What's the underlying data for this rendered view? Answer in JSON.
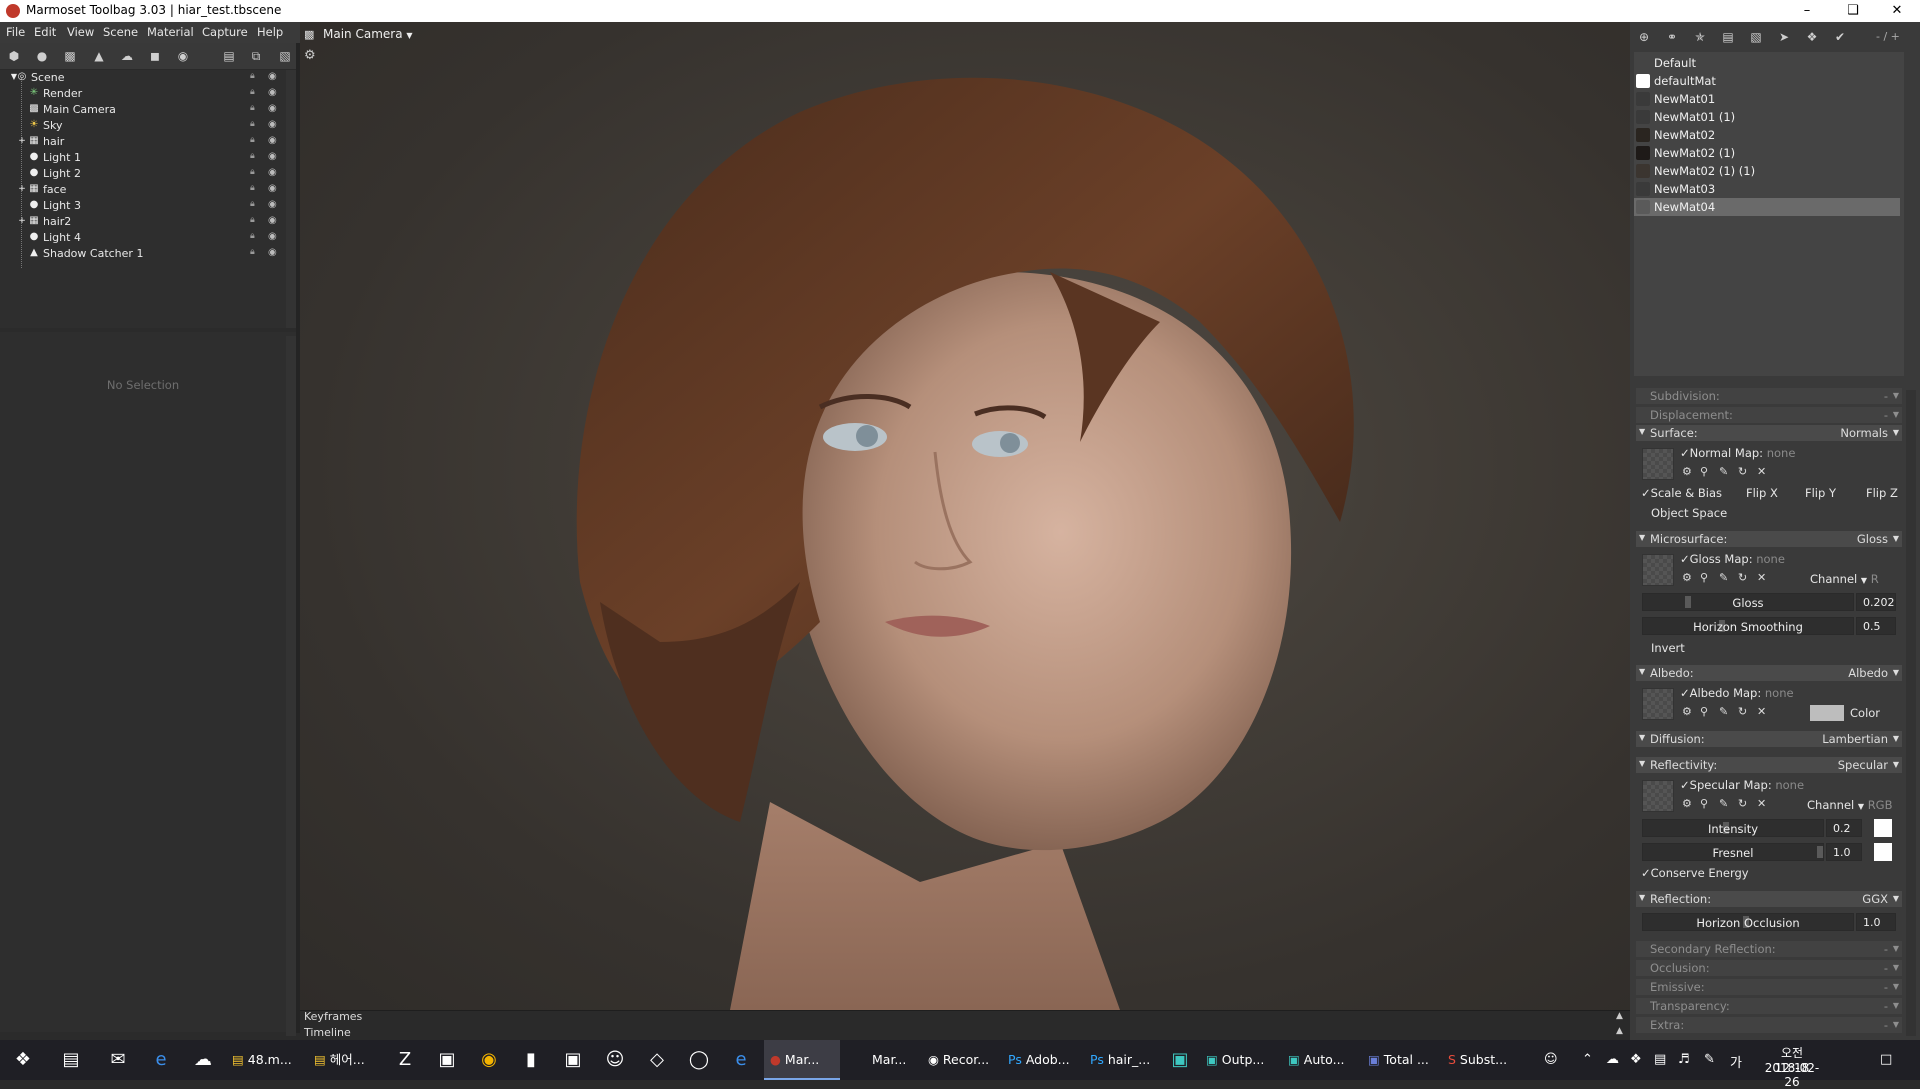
{
  "window": {
    "title": "Marmoset Toolbag 3.03  |  hiar_test.tbscene",
    "min_icon": "minimize-icon",
    "max_icon": "restore-icon",
    "close_icon": "close-icon"
  },
  "menu": [
    "File",
    "Edit",
    "View",
    "Scene",
    "Material",
    "Capture",
    "Help"
  ],
  "scene_tree": [
    {
      "label": "Scene",
      "icon": "scene-icon",
      "indent": 0
    },
    {
      "label": "Render",
      "icon": "render-icon",
      "indent": 1
    },
    {
      "label": "Main Camera",
      "icon": "camera-icon",
      "indent": 1
    },
    {
      "label": "Sky",
      "icon": "sky-icon",
      "indent": 1
    },
    {
      "label": "hair",
      "icon": "mesh-icon",
      "indent": 1,
      "expand": true
    },
    {
      "label": "Light 1",
      "icon": "light-icon",
      "indent": 1
    },
    {
      "label": "Light 2",
      "icon": "light-icon",
      "indent": 1
    },
    {
      "label": "face",
      "icon": "mesh-icon",
      "indent": 1,
      "expand": true
    },
    {
      "label": "Light 3",
      "icon": "light-icon",
      "indent": 1
    },
    {
      "label": "hair2",
      "icon": "mesh-icon",
      "indent": 1,
      "expand": true
    },
    {
      "label": "Light 4",
      "icon": "light-icon",
      "indent": 1
    },
    {
      "label": "Shadow Catcher 1",
      "icon": "shadow-catcher-icon",
      "indent": 1
    }
  ],
  "properties": {
    "empty_text": "No Selection"
  },
  "viewport": {
    "camera_label": "Main Camera"
  },
  "timeline": {
    "keyframes_label": "Keyframes",
    "timeline_label": "Timeline"
  },
  "material_toolbar": {
    "right_text": "- / +"
  },
  "materials": [
    {
      "name": "Default",
      "swatch": "#444444"
    },
    {
      "name": "defaultMat",
      "swatch": "#ffffff"
    },
    {
      "name": "NewMat01",
      "swatch": "#3a3a3a"
    },
    {
      "name": "NewMat01 (1)",
      "swatch": "#3a3a3a"
    },
    {
      "name": "NewMat02",
      "swatch": "#2a2520"
    },
    {
      "name": "NewMat02 (1)",
      "swatch": "#1e1a18"
    },
    {
      "name": "NewMat02 (1) (1)",
      "swatch": "#3b3530"
    },
    {
      "name": "NewMat03",
      "swatch": "#3a3a3a"
    },
    {
      "name": "NewMat04",
      "swatch": "#5a5a5a",
      "selected": true
    }
  ],
  "mat_sections": {
    "subdivision": {
      "name": "Subdivision:",
      "value": "-"
    },
    "displacement": {
      "name": "Displacement:",
      "value": "-"
    },
    "surface": {
      "name": "Surface:",
      "value": "Normals"
    },
    "microsurface": {
      "name": "Microsurface:",
      "value": "Gloss"
    },
    "albedo": {
      "name": "Albedo:",
      "value": "Albedo"
    },
    "diffusion": {
      "name": "Diffusion:",
      "value": "Lambertian"
    },
    "reflectivity": {
      "name": "Reflectivity:",
      "value": "Specular"
    },
    "reflection": {
      "name": "Reflection:",
      "value": "GGX"
    },
    "secondary": {
      "name": "Secondary Reflection:",
      "value": "-"
    },
    "occlusion": {
      "name": "Occlusion:",
      "value": "-"
    },
    "emissive": {
      "name": "Emissive:",
      "value": "-"
    },
    "transparency": {
      "name": "Transparency:",
      "value": "-"
    },
    "extra": {
      "name": "Extra:",
      "value": "-"
    }
  },
  "surface": {
    "normal_map": "Normal Map:",
    "normal_none": "none",
    "scale_bias": "Scale & Bias",
    "flip_x": "Flip X",
    "flip_y": "Flip Y",
    "flip_z": "Flip Z",
    "object_space": "Object Space"
  },
  "micro": {
    "gloss_map": "Gloss Map:",
    "gloss_none": "none",
    "channel": "Channel",
    "channel_value": "R",
    "gloss_label": "Gloss",
    "gloss_value": "0.202",
    "horizon_label": "Horizon Smoothing",
    "horizon_value": "0.5",
    "invert": "Invert"
  },
  "albedo": {
    "map": "Albedo Map:",
    "none": "none",
    "color": "Color",
    "color_value": "#bdbdbd"
  },
  "refl": {
    "map": "Specular Map:",
    "none": "none",
    "channel": "Channel",
    "channel_value": "RGB",
    "intensity_label": "Intensity",
    "intensity_value": "0.2",
    "fresnel_label": "Fresnel",
    "fresnel_value": "1.0",
    "conserve": "Conserve Energy"
  },
  "reflection": {
    "horizon_label": "Horizon Occlusion",
    "horizon_value": "1.0"
  },
  "taskbar": {
    "apps": [
      {
        "label": "48.m...",
        "icon": "folder-icon"
      },
      {
        "label": "헤어...",
        "icon": "folder-icon"
      },
      {
        "label": "Mar...",
        "icon": "marmoset-icon",
        "active": true
      },
      {
        "label": "Mar...",
        "icon": "marmoset-icon"
      },
      {
        "label": "Recor...",
        "icon": "recorder-icon"
      },
      {
        "label": "Adob...",
        "icon": "photoshop-icon"
      },
      {
        "label": "hair_...",
        "icon": "photoshop-icon"
      },
      {
        "label": "Outp...",
        "icon": "output-icon"
      },
      {
        "label": "Auto...",
        "icon": "autodesk-icon"
      },
      {
        "label": "Total ...",
        "icon": "save-icon"
      },
      {
        "label": "Subst...",
        "icon": "substance-icon"
      }
    ],
    "time": "오전 12:18",
    "date": "2018-02-26",
    "ime": "가"
  }
}
